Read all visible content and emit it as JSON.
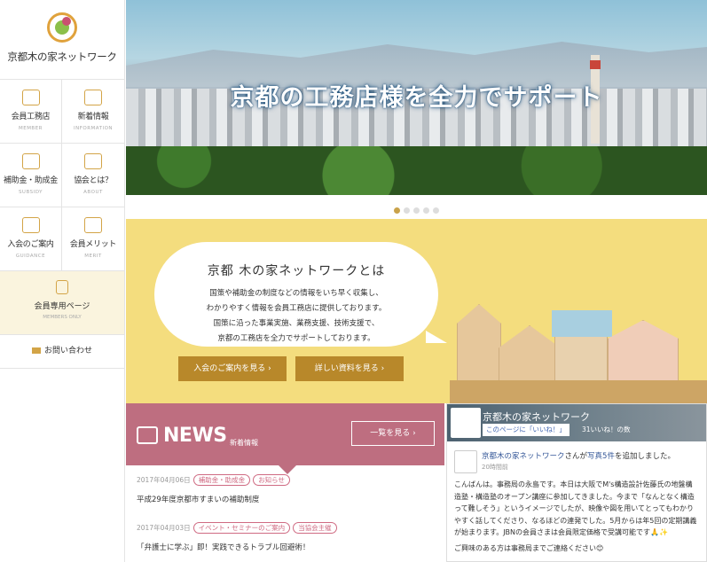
{
  "brand": {
    "name": "京都木の家ネットワーク"
  },
  "sidebar": {
    "items": [
      {
        "label": "会員工務店",
        "en": "MEMBER",
        "icon": "members-icon"
      },
      {
        "label": "新着情報",
        "en": "INFORMATION",
        "icon": "chat-icon"
      },
      {
        "label": "補助金・助成金",
        "en": "SUBSIDY",
        "icon": "yen-icon"
      },
      {
        "label": "協会とは？",
        "en": "ABOUT",
        "icon": "document-search-icon"
      },
      {
        "label": "入会のご案内",
        "en": "GUIDANCE",
        "icon": "megaphone-icon"
      },
      {
        "label": "会員メリット",
        "en": "MERIT",
        "icon": "pen-icon"
      }
    ],
    "members": {
      "label": "会員専用ページ",
      "en": "MEMBERS ONLY",
      "icon": "lock-icon"
    },
    "contact": {
      "label": "お問い合わせ",
      "icon": "mail-icon"
    }
  },
  "hero": {
    "title": "京都の工務店様を全力でサポート",
    "slides": 5,
    "active_slide": 1
  },
  "about": {
    "title": "京都 木の家ネットワークとは",
    "lines": [
      "国策や補助金の制度などの情報をいち早く収集し、",
      "わかりやすく情報を会員工務店に提供しております。",
      "国策に沿った事業実施、業務支援、技術支援で、",
      "京都の工務店を全力でサポートしております。"
    ],
    "btn_join": "入会のご案内を見る ›",
    "btn_docs": "詳しい資料を見る ›"
  },
  "news": {
    "title": "NEWS",
    "subtitle": "新着情報",
    "more": "一覧を見る ›",
    "items": [
      {
        "date": "2017年04月06日",
        "tags": [
          "補助金・助成金",
          "お知らせ"
        ],
        "title": "平成29年度京都市すまいの補助制度"
      },
      {
        "date": "2017年04月03日",
        "tags": [
          "イベント・セミナーのご案内",
          "当協会主催"
        ],
        "title": "「弁護士に学ぶ」即！実践できるトラブル回避術！"
      }
    ]
  },
  "facebook": {
    "page_name": "京都木の家ネットワーク",
    "like_label": "このページに「いいね！」",
    "like_count": "31いいね！の数",
    "post_author": "京都木の家ネットワーク",
    "post_action": "さんが",
    "post_photos": "写真5件",
    "post_action2": "を追加しました。",
    "post_time": "20時間前",
    "body1": "こんばんは。事務局の永島です。本日は大阪でM's構造設計佐藤氏の地盤構造塾・構造塾のオープン講座に参加してきました。今まで「なんとなく構造って難しそう」というイメージでしたが、映像や図を用いてとってもわかりやすく話してくださり、なるほどの連発でした。5月からは年5回の定期講義が始まります。JBNの会員さまは会員限定価格で受講可能です🙏✨",
    "body2": "ご興味のある方は事務局までご連絡ください😊"
  },
  "colors": {
    "gold": "#b8882a",
    "news": "#be6e80",
    "about_bg": "#f4dd7e"
  }
}
